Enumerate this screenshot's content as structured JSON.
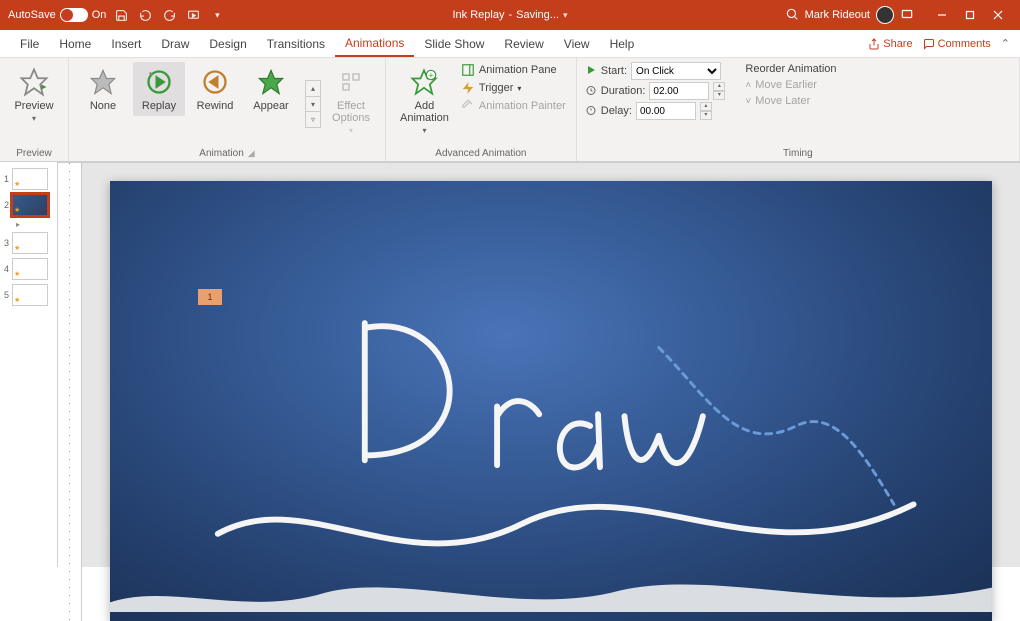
{
  "titlebar": {
    "autosave_label": "AutoSave",
    "autosave_state": "On",
    "doc_title": "Ink Replay",
    "doc_status": "Saving...",
    "user": "Mark Rideout"
  },
  "tabs": {
    "items": [
      "File",
      "Home",
      "Insert",
      "Draw",
      "Design",
      "Transitions",
      "Animations",
      "Slide Show",
      "Review",
      "View",
      "Help"
    ],
    "active_index": 6,
    "share": "Share",
    "comments": "Comments"
  },
  "ribbon": {
    "preview": {
      "label": "Preview",
      "group": "Preview"
    },
    "animation": {
      "group": "Animation",
      "none": "None",
      "replay": "Replay",
      "rewind": "Rewind",
      "appear": "Appear",
      "effect_options": "Effect\nOptions"
    },
    "advanced": {
      "group": "Advanced Animation",
      "add": "Add\nAnimation",
      "pane": "Animation Pane",
      "trigger": "Trigger",
      "painter": "Animation Painter"
    },
    "timing": {
      "group": "Timing",
      "start_label": "Start:",
      "start_value": "On Click",
      "duration_label": "Duration:",
      "duration_value": "02.00",
      "delay_label": "Delay:",
      "delay_value": "00.00",
      "reorder": "Reorder Animation",
      "earlier": "Move Earlier",
      "later": "Move Later"
    }
  },
  "thumbs": {
    "count": 5,
    "selected": 2
  },
  "slide": {
    "tag": "1",
    "ink_text": "Draw"
  },
  "colors": {
    "accent": "#c43e1c",
    "slide_bg": "#2f4f82"
  }
}
